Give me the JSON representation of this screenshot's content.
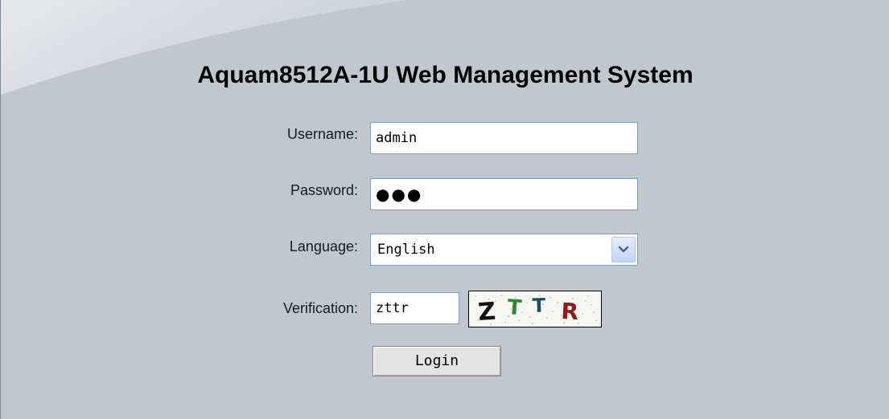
{
  "header": {
    "title": "Aquam8512A-1U Web Management System"
  },
  "form": {
    "username_label": "Username:",
    "username_value": "admin",
    "password_label": "Password:",
    "password_mask": "●●●",
    "language_label": "Language:",
    "language_value": "English",
    "verification_label": "Verification:",
    "verification_value": "zttr",
    "captcha_text": "ZTTR",
    "login_label": "Login"
  },
  "icons": {
    "language_dropdown": "chevron-down-icon"
  }
}
